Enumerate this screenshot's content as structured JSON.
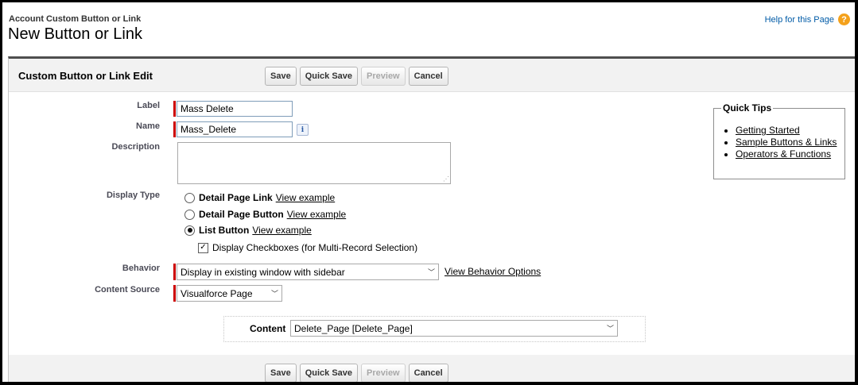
{
  "page": {
    "breadcrumb": "Account Custom Button or Link",
    "title": "New Button or Link",
    "help_link": "Help for this Page",
    "help_icon": "question-circle-icon"
  },
  "section": {
    "title": "Custom Button or Link Edit",
    "buttons": {
      "save": "Save",
      "quick_save": "Quick Save",
      "preview": "Preview",
      "cancel": "Cancel"
    }
  },
  "form": {
    "label": {
      "label": "Label",
      "value": "Mass Delete"
    },
    "name": {
      "label": "Name",
      "value": "Mass_Delete",
      "info_icon": "info-icon"
    },
    "description": {
      "label": "Description",
      "value": ""
    },
    "display_type": {
      "label": "Display Type",
      "options": [
        {
          "label": "Detail Page Link",
          "link": "View example",
          "selected": false
        },
        {
          "label": "Detail Page Button",
          "link": "View example",
          "selected": false
        },
        {
          "label": "List Button",
          "link": "View example",
          "selected": true
        }
      ],
      "checkbox": {
        "label": "Display Checkboxes (for Multi-Record Selection)",
        "checked": true
      }
    },
    "behavior": {
      "label": "Behavior",
      "value": "Display in existing window with sidebar",
      "link": "View Behavior Options"
    },
    "content_source": {
      "label": "Content Source",
      "value": "Visualforce Page"
    },
    "content": {
      "label": "Content",
      "value": "Delete_Page [Delete_Page]"
    }
  },
  "quick_tips": {
    "title": "Quick Tips",
    "links": [
      "Getting Started",
      "Sample Buttons & Links",
      "Operators & Functions"
    ]
  },
  "colors": {
    "required_bar": "#cc0000",
    "panel_border": "#4f4f4f",
    "help_icon": "#f4a11b",
    "link": "#015ba7"
  }
}
